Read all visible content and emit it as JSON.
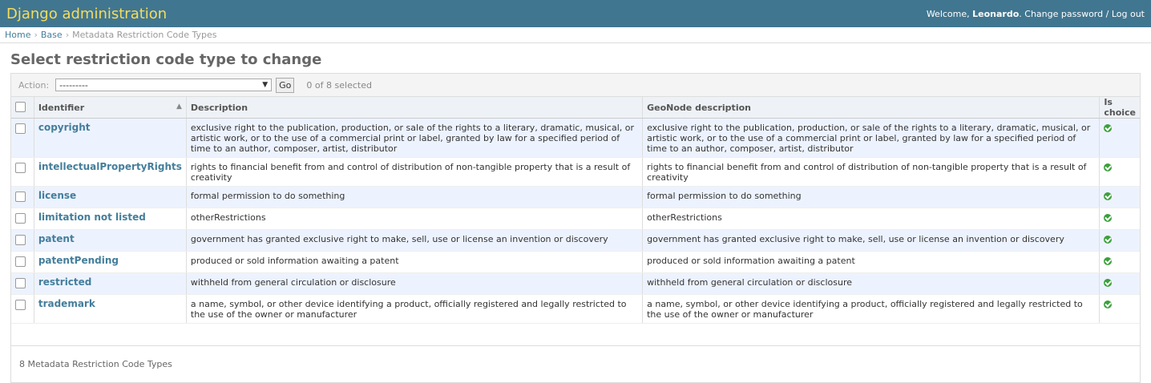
{
  "header": {
    "branding": "Django administration",
    "welcome": "Welcome, ",
    "username": "Leonardo",
    "change_password": "Change password",
    "separator": " / ",
    "logout": "Log out"
  },
  "breadcrumbs": [
    "Home",
    "Base",
    "Metadata Restriction Code Types"
  ],
  "page_title": "Select restriction code type to change",
  "actions": {
    "label": "Action:",
    "selected_value": "---------",
    "go_label": "Go",
    "selected_count": "0 of 8 selected"
  },
  "columns": [
    "Identifier",
    "Description",
    "GeoNode description",
    "Is choice"
  ],
  "rows": [
    {
      "identifier": "copyright",
      "description": "exclusive right to the publication, production, or sale of the rights to a literary, dramatic, musical, or artistic work, or to the use of a commercial print or label, granted by law for a specified period of time to an author, composer, artist, distributor",
      "gn_description": "exclusive right to the publication, production, or sale of the rights to a literary, dramatic, musical, or artistic work, or to the use of a commercial print or label, granted by law for a specified period of time to an author, composer, artist, distributor"
    },
    {
      "identifier": "intellectualPropertyRights",
      "description": "rights to financial benefit from and control of distribution of non-tangible property that is a result of creativity",
      "gn_description": "rights to financial benefit from and control of distribution of non-tangible property that is a result of creativity"
    },
    {
      "identifier": "license",
      "description": "formal permission to do something",
      "gn_description": "formal permission to do something"
    },
    {
      "identifier": "limitation not listed",
      "description": "otherRestrictions",
      "gn_description": "otherRestrictions"
    },
    {
      "identifier": "patent",
      "description": "government has granted exclusive right to make, sell, use or license an invention or discovery",
      "gn_description": "government has granted exclusive right to make, sell, use or license an invention or discovery"
    },
    {
      "identifier": "patentPending",
      "description": "produced or sold information awaiting a patent",
      "gn_description": "produced or sold information awaiting a patent"
    },
    {
      "identifier": "restricted",
      "description": "withheld from general circulation or disclosure",
      "gn_description": "withheld from general circulation or disclosure"
    },
    {
      "identifier": "trademark",
      "description": "a name, symbol, or other device identifying a product, officially registered and legally restricted to the use of the owner or manufacturer",
      "gn_description": "a name, symbol, or other device identifying a product, officially registered and legally restricted to the use of the owner or manufacturer"
    }
  ],
  "paginator": "8 Metadata Restriction Code Types",
  "colors": {
    "header_bg": "#417690",
    "branding": "#f5dd5d",
    "link": "#447e9b",
    "check": "#3ca03c"
  }
}
